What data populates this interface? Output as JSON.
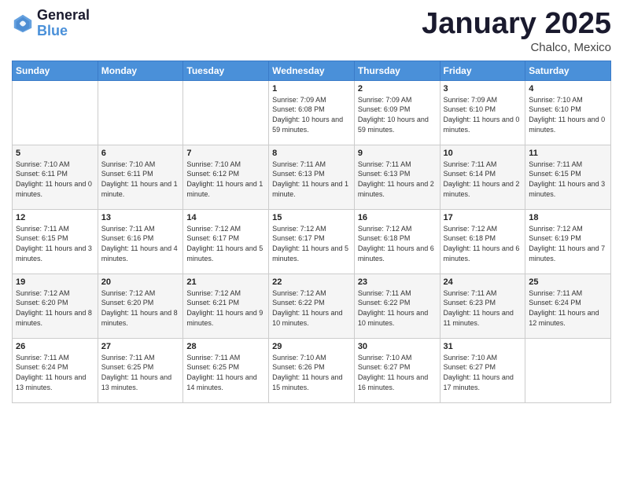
{
  "logo": {
    "line1": "General",
    "line2": "Blue"
  },
  "title": "January 2025",
  "location": "Chalco, Mexico",
  "weekdays": [
    "Sunday",
    "Monday",
    "Tuesday",
    "Wednesday",
    "Thursday",
    "Friday",
    "Saturday"
  ],
  "weeks": [
    [
      {
        "day": "",
        "sunrise": "",
        "sunset": "",
        "daylight": ""
      },
      {
        "day": "",
        "sunrise": "",
        "sunset": "",
        "daylight": ""
      },
      {
        "day": "",
        "sunrise": "",
        "sunset": "",
        "daylight": ""
      },
      {
        "day": "1",
        "sunrise": "Sunrise: 7:09 AM",
        "sunset": "Sunset: 6:08 PM",
        "daylight": "Daylight: 10 hours and 59 minutes."
      },
      {
        "day": "2",
        "sunrise": "Sunrise: 7:09 AM",
        "sunset": "Sunset: 6:09 PM",
        "daylight": "Daylight: 10 hours and 59 minutes."
      },
      {
        "day": "3",
        "sunrise": "Sunrise: 7:09 AM",
        "sunset": "Sunset: 6:10 PM",
        "daylight": "Daylight: 11 hours and 0 minutes."
      },
      {
        "day": "4",
        "sunrise": "Sunrise: 7:10 AM",
        "sunset": "Sunset: 6:10 PM",
        "daylight": "Daylight: 11 hours and 0 minutes."
      }
    ],
    [
      {
        "day": "5",
        "sunrise": "Sunrise: 7:10 AM",
        "sunset": "Sunset: 6:11 PM",
        "daylight": "Daylight: 11 hours and 0 minutes."
      },
      {
        "day": "6",
        "sunrise": "Sunrise: 7:10 AM",
        "sunset": "Sunset: 6:11 PM",
        "daylight": "Daylight: 11 hours and 1 minute."
      },
      {
        "day": "7",
        "sunrise": "Sunrise: 7:10 AM",
        "sunset": "Sunset: 6:12 PM",
        "daylight": "Daylight: 11 hours and 1 minute."
      },
      {
        "day": "8",
        "sunrise": "Sunrise: 7:11 AM",
        "sunset": "Sunset: 6:13 PM",
        "daylight": "Daylight: 11 hours and 1 minute."
      },
      {
        "day": "9",
        "sunrise": "Sunrise: 7:11 AM",
        "sunset": "Sunset: 6:13 PM",
        "daylight": "Daylight: 11 hours and 2 minutes."
      },
      {
        "day": "10",
        "sunrise": "Sunrise: 7:11 AM",
        "sunset": "Sunset: 6:14 PM",
        "daylight": "Daylight: 11 hours and 2 minutes."
      },
      {
        "day": "11",
        "sunrise": "Sunrise: 7:11 AM",
        "sunset": "Sunset: 6:15 PM",
        "daylight": "Daylight: 11 hours and 3 minutes."
      }
    ],
    [
      {
        "day": "12",
        "sunrise": "Sunrise: 7:11 AM",
        "sunset": "Sunset: 6:15 PM",
        "daylight": "Daylight: 11 hours and 3 minutes."
      },
      {
        "day": "13",
        "sunrise": "Sunrise: 7:11 AM",
        "sunset": "Sunset: 6:16 PM",
        "daylight": "Daylight: 11 hours and 4 minutes."
      },
      {
        "day": "14",
        "sunrise": "Sunrise: 7:12 AM",
        "sunset": "Sunset: 6:17 PM",
        "daylight": "Daylight: 11 hours and 5 minutes."
      },
      {
        "day": "15",
        "sunrise": "Sunrise: 7:12 AM",
        "sunset": "Sunset: 6:17 PM",
        "daylight": "Daylight: 11 hours and 5 minutes."
      },
      {
        "day": "16",
        "sunrise": "Sunrise: 7:12 AM",
        "sunset": "Sunset: 6:18 PM",
        "daylight": "Daylight: 11 hours and 6 minutes."
      },
      {
        "day": "17",
        "sunrise": "Sunrise: 7:12 AM",
        "sunset": "Sunset: 6:18 PM",
        "daylight": "Daylight: 11 hours and 6 minutes."
      },
      {
        "day": "18",
        "sunrise": "Sunrise: 7:12 AM",
        "sunset": "Sunset: 6:19 PM",
        "daylight": "Daylight: 11 hours and 7 minutes."
      }
    ],
    [
      {
        "day": "19",
        "sunrise": "Sunrise: 7:12 AM",
        "sunset": "Sunset: 6:20 PM",
        "daylight": "Daylight: 11 hours and 8 minutes."
      },
      {
        "day": "20",
        "sunrise": "Sunrise: 7:12 AM",
        "sunset": "Sunset: 6:20 PM",
        "daylight": "Daylight: 11 hours and 8 minutes."
      },
      {
        "day": "21",
        "sunrise": "Sunrise: 7:12 AM",
        "sunset": "Sunset: 6:21 PM",
        "daylight": "Daylight: 11 hours and 9 minutes."
      },
      {
        "day": "22",
        "sunrise": "Sunrise: 7:12 AM",
        "sunset": "Sunset: 6:22 PM",
        "daylight": "Daylight: 11 hours and 10 minutes."
      },
      {
        "day": "23",
        "sunrise": "Sunrise: 7:11 AM",
        "sunset": "Sunset: 6:22 PM",
        "daylight": "Daylight: 11 hours and 10 minutes."
      },
      {
        "day": "24",
        "sunrise": "Sunrise: 7:11 AM",
        "sunset": "Sunset: 6:23 PM",
        "daylight": "Daylight: 11 hours and 11 minutes."
      },
      {
        "day": "25",
        "sunrise": "Sunrise: 7:11 AM",
        "sunset": "Sunset: 6:24 PM",
        "daylight": "Daylight: 11 hours and 12 minutes."
      }
    ],
    [
      {
        "day": "26",
        "sunrise": "Sunrise: 7:11 AM",
        "sunset": "Sunset: 6:24 PM",
        "daylight": "Daylight: 11 hours and 13 minutes."
      },
      {
        "day": "27",
        "sunrise": "Sunrise: 7:11 AM",
        "sunset": "Sunset: 6:25 PM",
        "daylight": "Daylight: 11 hours and 13 minutes."
      },
      {
        "day": "28",
        "sunrise": "Sunrise: 7:11 AM",
        "sunset": "Sunset: 6:25 PM",
        "daylight": "Daylight: 11 hours and 14 minutes."
      },
      {
        "day": "29",
        "sunrise": "Sunrise: 7:10 AM",
        "sunset": "Sunset: 6:26 PM",
        "daylight": "Daylight: 11 hours and 15 minutes."
      },
      {
        "day": "30",
        "sunrise": "Sunrise: 7:10 AM",
        "sunset": "Sunset: 6:27 PM",
        "daylight": "Daylight: 11 hours and 16 minutes."
      },
      {
        "day": "31",
        "sunrise": "Sunrise: 7:10 AM",
        "sunset": "Sunset: 6:27 PM",
        "daylight": "Daylight: 11 hours and 17 minutes."
      },
      {
        "day": "",
        "sunrise": "",
        "sunset": "",
        "daylight": ""
      }
    ]
  ]
}
